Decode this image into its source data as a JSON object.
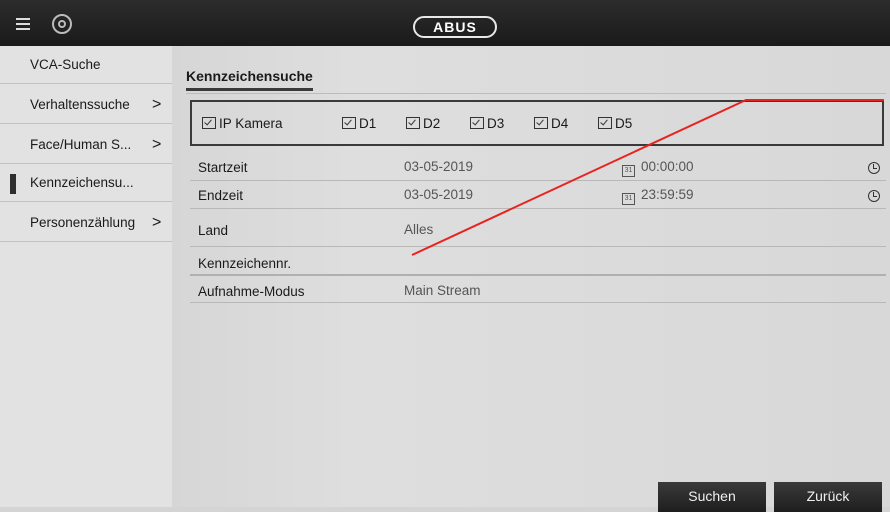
{
  "header": {
    "logo": "ABUS"
  },
  "sidebar": {
    "items": [
      {
        "label": "VCA-Suche",
        "chevron": ""
      },
      {
        "label": "Verhaltenssuche",
        "chevron": ">"
      },
      {
        "label": "Face/Human S...",
        "chevron": ">"
      },
      {
        "label": "Kennzeichensu...",
        "chevron": ""
      },
      {
        "label": "Personenzählung",
        "chevron": ">"
      }
    ]
  },
  "main": {
    "tab": "Kennzeichensuche",
    "channels": [
      "IP Kamera",
      "D1",
      "D2",
      "D3",
      "D4",
      "D5"
    ],
    "fields": {
      "start": {
        "label": "Startzeit",
        "date": "03-05-2019",
        "time": "00:00:00"
      },
      "end": {
        "label": "Endzeit",
        "date": "03-05-2019",
        "time": "23:59:59"
      },
      "country": {
        "label": "Land",
        "value": "Alles"
      },
      "plate": {
        "label": "Kennzeichennr.",
        "value": ""
      },
      "mode": {
        "label": "Aufnahme-Modus",
        "value": "Main Stream"
      }
    },
    "calendar_glyph": "31"
  },
  "buttons": {
    "search": "Suchen",
    "back": "Zurück"
  },
  "colors": {
    "annotation_line": "#e8231f",
    "topbar": "#222222"
  }
}
